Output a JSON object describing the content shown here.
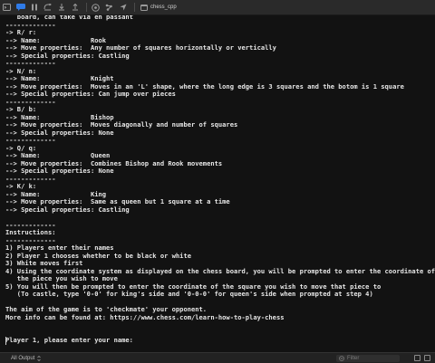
{
  "toolbar": {
    "scheme_name": "chess_cpp",
    "icons": [
      "terminal-icon",
      "chat-bubble-icon",
      "pause-icon",
      "step-over-icon",
      "step-into-icon",
      "step-out-icon",
      "debug-view-icon",
      "memory-icon",
      "location-icon",
      "scheme-icon"
    ]
  },
  "console": {
    "lines": [
      "   board, can take via en passant",
      "-------------",
      "-> R/ r:",
      "--> Name:             Rook",
      "--> Move properties:  Any number of squares horizontally or vertically",
      "--> Special properties: Castling",
      "-------------",
      "-> N/ n:",
      "--> Name:             Knight",
      "--> Move properties:  Moves in an 'L' shape, where the long edge is 3 squares and the botom is 1 square",
      "--> Special properties: Can jump over pieces",
      "-------------",
      "-> B/ b:",
      "--> Name:             Bishop",
      "--> Move properties:  Moves diagonally and number of squares",
      "--> Special properties: None",
      "-------------",
      "-> Q/ q:",
      "--> Name:             Queen",
      "--> Move properties:  Combines Bishop and Rook movements",
      "--> Special properties: None",
      "-------------",
      "-> K/ k:",
      "--> Name:             King",
      "--> Move properties:  Same as queen but 1 square at a time",
      "--> Special properties: Castling",
      "",
      "-------------",
      "Instructions:",
      "-------------",
      "1) Players enter their names",
      "2) Player 1 chooses whether to be black or white",
      "3) White moves first",
      "4) Using the coordinate system as displayed on the chess board, you will be prompted to enter the coordinate of",
      "   the piece you wish to move",
      "5) You will then be prompted to enter the coordinate of the square you wish to move that piece to",
      "   (To castle, type '0-0' for king's side and '0-0-0' for queen's side when prompted at step 4)",
      "",
      "The aim of the game is to 'checkmate' your opponent.",
      "More info can be found at: https://www.chess.com/learn-how-to-play-chess",
      "",
      "",
      "Player 1, please enter your name:",
      ""
    ]
  },
  "bottom": {
    "output_selector": "All Output",
    "filter_placeholder": "Filter"
  }
}
